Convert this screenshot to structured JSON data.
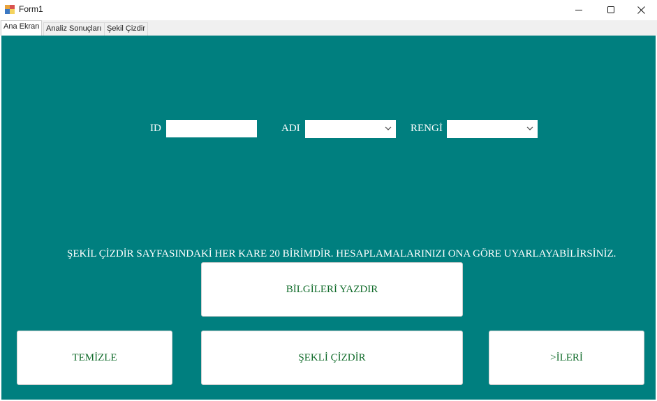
{
  "window": {
    "title": "Form1",
    "controls": {
      "minimize": "minimize-icon",
      "maximize": "maximize-icon",
      "close": "close-icon"
    }
  },
  "tabs": [
    {
      "label": "Ana Ekran",
      "active": true
    },
    {
      "label": "Analiz Sonuçları",
      "active": false
    },
    {
      "label": "Şekil Çizdir",
      "active": false
    }
  ],
  "form": {
    "id_label": "ID",
    "id_value": "",
    "name_label": "ADI",
    "name_value": "",
    "color_label": "RENGİ",
    "color_value": "",
    "info_text": "ŞEKİL ÇİZDİR SAYFASINDAKİ HER KARE 20 BİRİMDİR. HESAPLAMALARINIZI ONA GÖRE UYARLAYABİLİRSİNİZ."
  },
  "buttons": {
    "print_info": "BİLGİLERİ YAZDIR",
    "clear": "TEMİZLE",
    "draw_shape": "ŞEKLİ ÇİZDİR",
    "next": ">İLERİ"
  },
  "colors": {
    "panel_background": "#007f7f",
    "button_text": "#106b2a",
    "label_text": "#ffffff"
  }
}
